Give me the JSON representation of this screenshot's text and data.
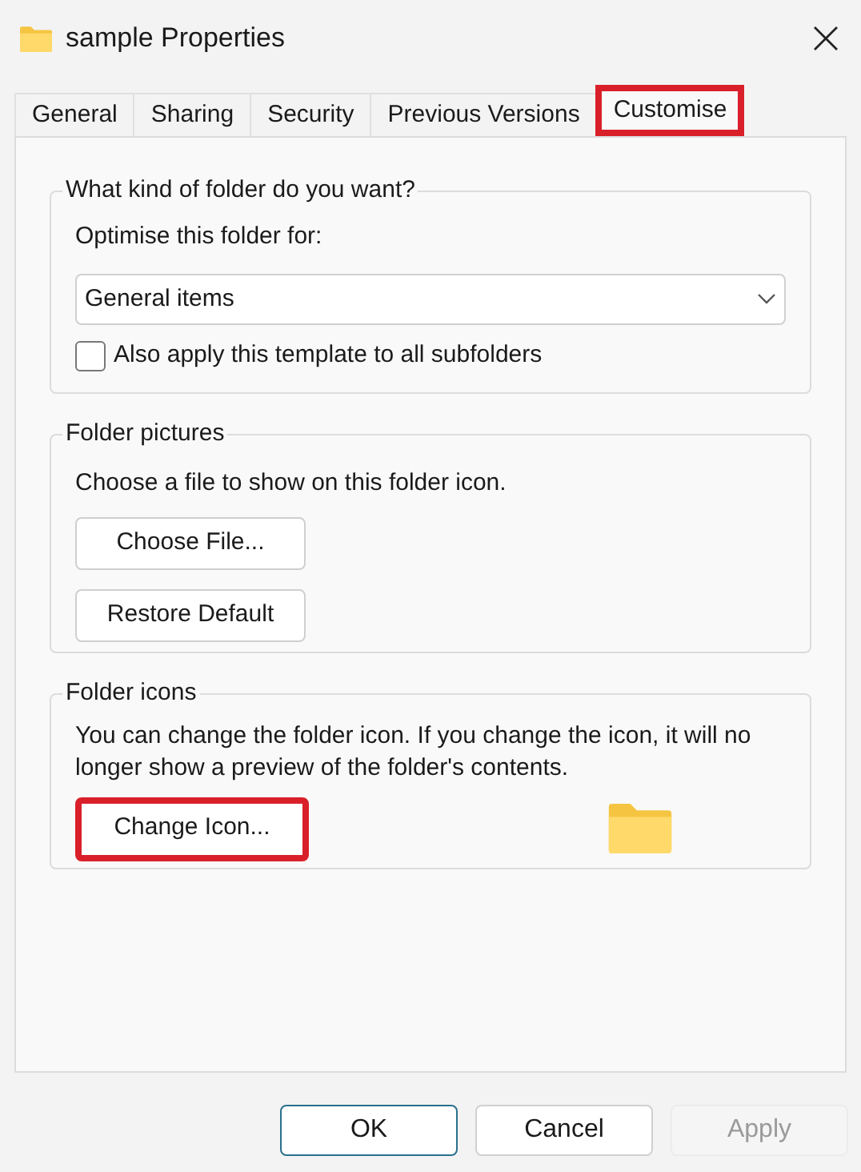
{
  "window": {
    "title": "sample Properties"
  },
  "tabs": [
    {
      "label": "General",
      "selected": false,
      "highlighted": false
    },
    {
      "label": "Sharing",
      "selected": false,
      "highlighted": false
    },
    {
      "label": "Security",
      "selected": false,
      "highlighted": false
    },
    {
      "label": "Previous Versions",
      "selected": false,
      "highlighted": false
    },
    {
      "label": "Customise",
      "selected": true,
      "highlighted": true
    }
  ],
  "folder_type": {
    "title": "What kind of folder do you want?",
    "label": "Optimise this folder for:",
    "value": "General items",
    "checkbox": {
      "label": "Also apply this template to all subfolders",
      "checked": false
    }
  },
  "folder_pictures": {
    "title": "Folder pictures",
    "description": "Choose a file to show on this folder icon.",
    "buttons": [
      {
        "label": "Choose File...",
        "highlighted": false
      },
      {
        "label": "Restore Default",
        "highlighted": false
      }
    ]
  },
  "folder_icons": {
    "title": "Folder icons",
    "description": "You can change the folder icon. If you change the icon, it will no longer show a preview of the folder's contents.",
    "button": {
      "label": "Change Icon...",
      "highlighted": true
    }
  },
  "buttons": [
    {
      "label": "OK",
      "default": true,
      "disabled": false
    },
    {
      "label": "Cancel",
      "default": false,
      "disabled": false
    },
    {
      "label": "Apply",
      "default": false,
      "disabled": true
    }
  ]
}
